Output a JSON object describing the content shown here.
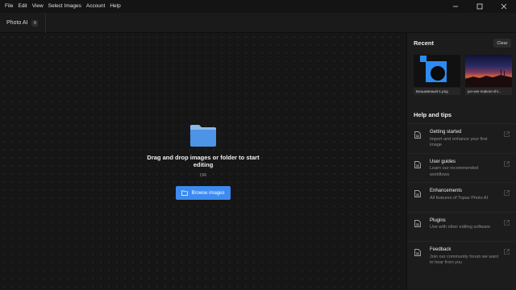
{
  "menu": [
    "File",
    "Edit",
    "View",
    "Select Images",
    "Account",
    "Help"
  ],
  "window_controls": [
    "minimize-icon",
    "maximize-icon",
    "close-icon"
  ],
  "tab": {
    "label": "Photo AI",
    "badge": "8"
  },
  "dropzone": {
    "text": "Drag and drop images or folder to start editing",
    "or": "OR",
    "browse_label": "Browse images",
    "accent": "#3d8bf0"
  },
  "sidebar": {
    "recent_title": "Recent",
    "clear_label": "Clear",
    "recent": [
      {
        "caption": "Безымянный-1.png"
      },
      {
        "caption": "jun-wei-makoto-shi..."
      }
    ],
    "help_title": "Help and tips",
    "help_items": [
      {
        "title": "Getting started",
        "desc": "Import and enhance your first image"
      },
      {
        "title": "User guides",
        "desc": "Learn our recommended workflows"
      },
      {
        "title": "Enhancements",
        "desc": "All features of Topaz Photo AI"
      },
      {
        "title": "Plugins",
        "desc": "Use with other editing software"
      },
      {
        "title": "Feedback",
        "desc": "Join our community forum we want to hear from you"
      }
    ]
  }
}
